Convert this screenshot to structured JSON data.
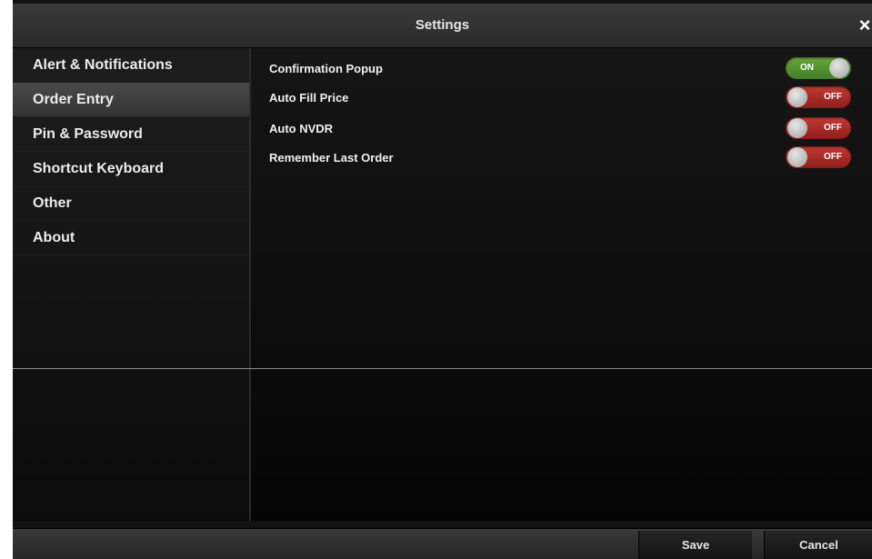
{
  "dialog": {
    "title": "Settings",
    "close_glyph": "×"
  },
  "sidebar": {
    "items": [
      {
        "label": "Alert & Notifications",
        "active": false
      },
      {
        "label": "Order Entry",
        "active": true
      },
      {
        "label": "Pin & Password",
        "active": false
      },
      {
        "label": "Shortcut Keyboard",
        "active": false
      },
      {
        "label": "Other",
        "active": false
      },
      {
        "label": "About",
        "active": false
      }
    ]
  },
  "settings": [
    {
      "label": "Confirmation Popup",
      "state": "ON",
      "enabled": true
    },
    {
      "label": "Auto Fill Price",
      "state": "OFF",
      "enabled": false
    },
    {
      "label": "Auto NVDR",
      "state": "OFF",
      "enabled": false
    },
    {
      "label": "Remember Last Order",
      "state": "OFF",
      "enabled": false
    }
  ],
  "footer": {
    "save_label": "Save",
    "cancel_label": "Cancel"
  },
  "colors": {
    "toggle_on": "#4f8f2e",
    "toggle_off": "#a82a25",
    "background": "#121212"
  },
  "icons": {
    "close": "close-icon"
  }
}
